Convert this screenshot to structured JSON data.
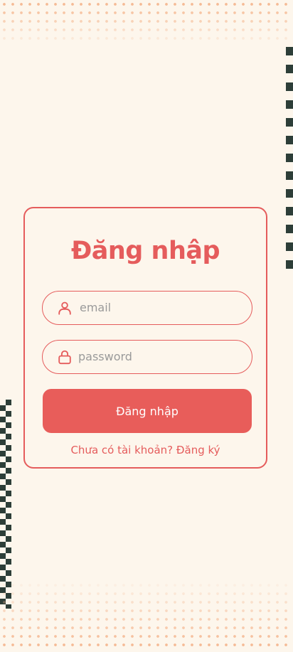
{
  "login_card": {
    "title": "Đăng nhập",
    "email_field": {
      "icon": "user-icon",
      "placeholder": "email",
      "value": ""
    },
    "password_field": {
      "icon": "lock-icon",
      "placeholder": "password",
      "value": ""
    },
    "submit_label": "Đăng nhập",
    "register_link": "Chưa có tài khoản? Đăng ký"
  },
  "colors": {
    "accent": "#e55c5c",
    "background": "#fdf6ec",
    "dots": "#f4b48c",
    "pattern_dark": "#2d3e38"
  }
}
